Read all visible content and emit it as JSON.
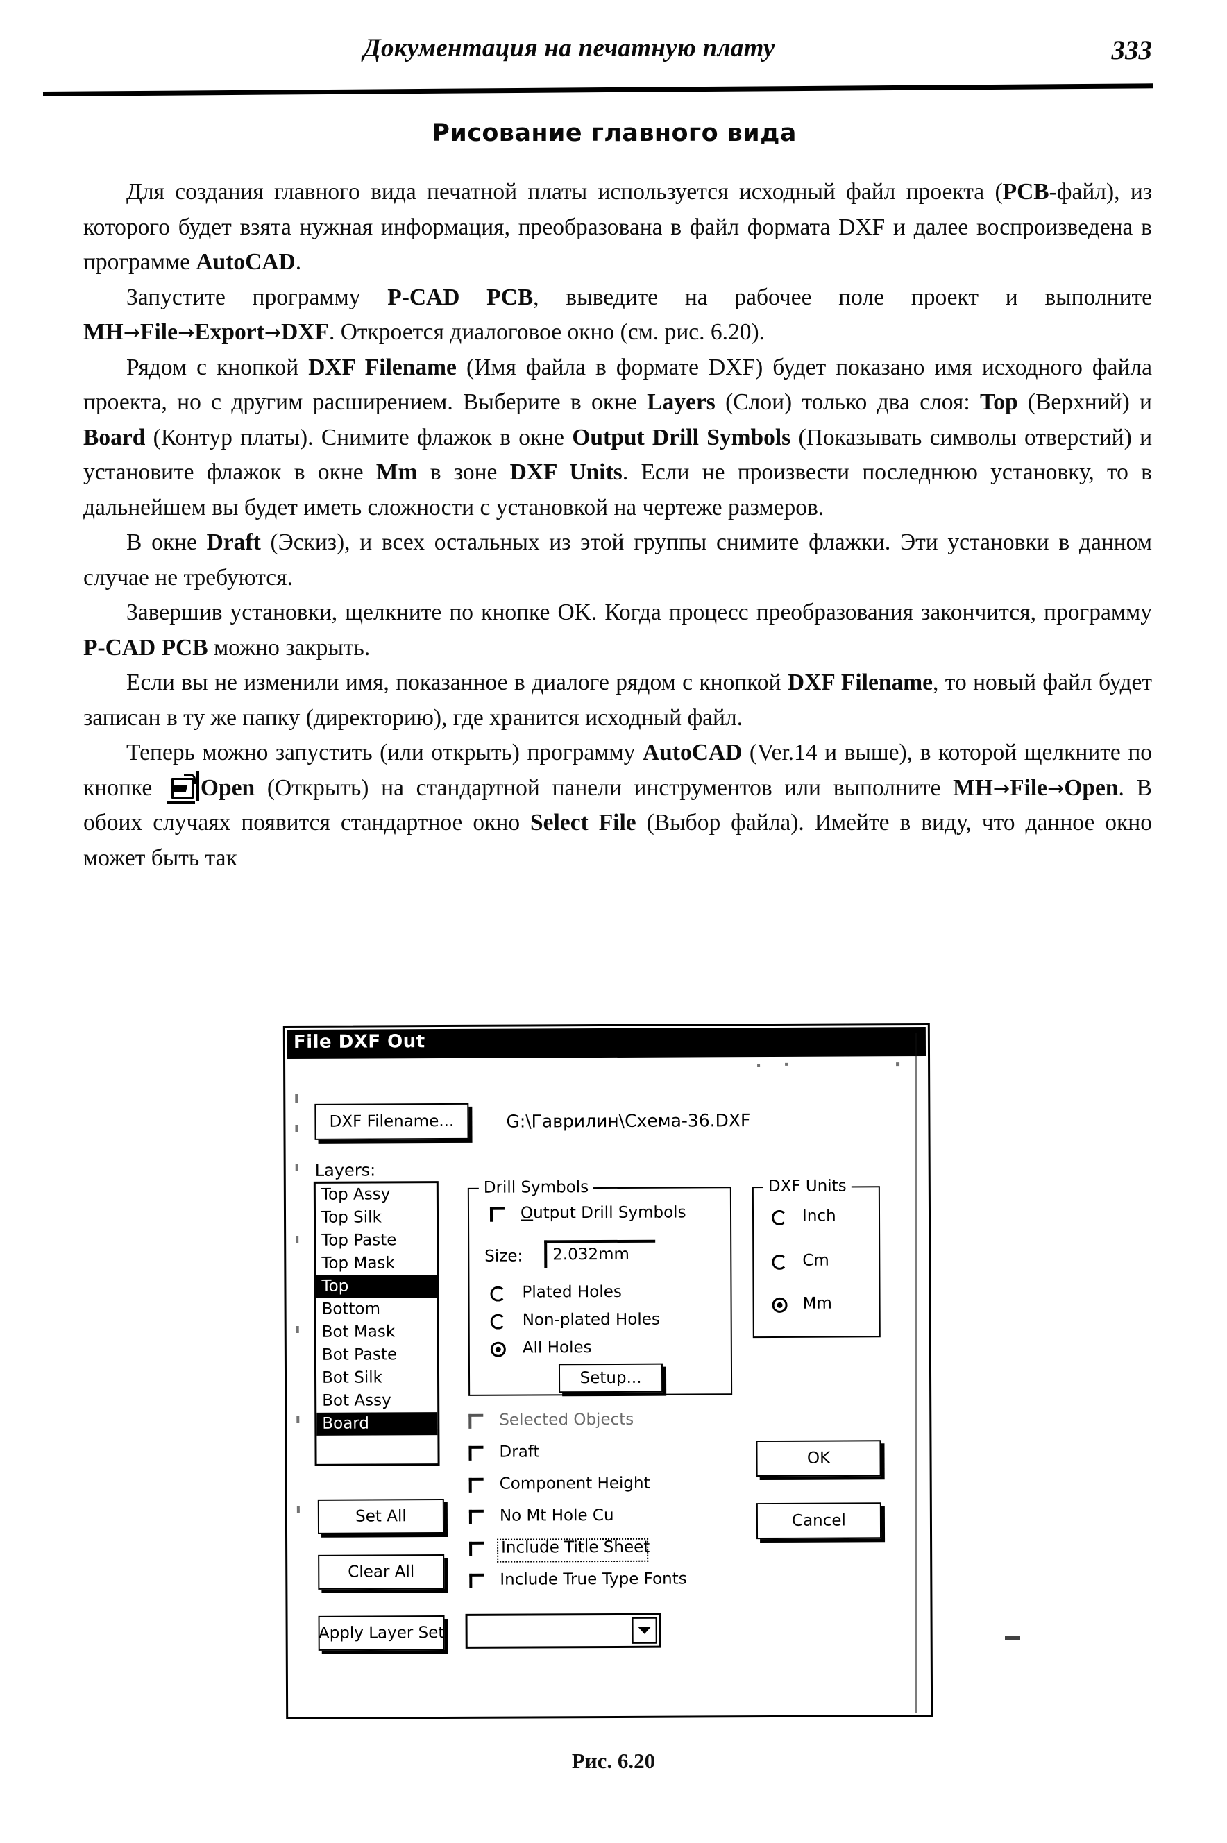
{
  "header": {
    "running_title": "Документация на печатную плату",
    "page_number": "333"
  },
  "section": {
    "heading": "Рисование главного вида"
  },
  "paragraphs": {
    "p1_a": "Для создания главного вида печатной платы используется исходный файл проекта (",
    "p1_b": "PCB",
    "p1_c": "-файл), из которого будет взята нужная информация, преобразована в файл формата DXF и далее воспроизведена в программе ",
    "p1_d": "AutoCAD",
    "p1_e": ".",
    "p2_a": "Запустите программу ",
    "p2_b": "P-CAD PCB",
    "p2_c": ", выведите на рабочее поле проект и выполните ",
    "p2_d": "MH",
    "p2_arrow1": "→",
    "p2_e": "File",
    "p2_arrow2": "→",
    "p2_f": "Export",
    "p2_arrow3": "→",
    "p2_g": "DXF",
    "p2_h": ". Откроется диалоговое окно (см. рис. 6.20).",
    "p3_a": "Рядом с кнопкой ",
    "p3_b": "DXF Filename",
    "p3_c": " (Имя файла в формате DXF) будет показано имя исходного файла проекта, но с другим расширением. Выберите в окне ",
    "p3_d": "Layers",
    "p3_e": " (Слои) только два слоя: ",
    "p3_f": "Top",
    "p3_g": " (Верхний) и ",
    "p3_h": "Board",
    "p3_i": " (Контур платы). Снимите флажок в окне ",
    "p3_j": "Output Drill Symbols",
    "p3_k": " (Показывать символы отверстий) и установите флажок в окне ",
    "p3_l": "Mm",
    "p3_m": " в зоне ",
    "p3_n": "DXF Units",
    "p3_o": ". Если не произвести последнюю установку, то в дальнейшем вы будет иметь сложности с установкой на чертеже размеров.",
    "p4_a": "В окне ",
    "p4_b": "Draft",
    "p4_c": " (Эскиз), и всех остальных из этой группы снимите флажки. Эти установки в данном случае не требуются.",
    "p5_a": "Завершив установки, щелкните по кнопке ",
    "p5_b": "OK",
    "p5_c": ". Когда процесс преобразования закончится, программу ",
    "p5_d": "P-CAD PCB",
    "p5_e": " можно закрыть.",
    "p6_a": "Если вы не изменили имя, показанное в диалоге рядом с кнопкой ",
    "p6_b": "DXF Filename",
    "p6_c": ", то новый файл будет записан в ту же папку (директорию), где хранится исходный файл.",
    "p7_a": "Теперь можно запустить (или открыть) программу ",
    "p7_b": "AutoCAD",
    "p7_c": " (Ver.14 и выше), в которой щелкните по кнопке ",
    "p7_icon": "open-folder-icon",
    "p7_d": "Open",
    "p7_e": " (Открыть) на стандартной панели инструментов или выполните ",
    "p7_f": "MH",
    "p7_arrow1": "→",
    "p7_g": "File",
    "p7_arrow2": "→",
    "p7_h": "Open",
    "p7_i": ". В обоих случаях появится стандартное окно ",
    "p7_j": "Select File",
    "p7_k": " (Выбор файла). Имейте в виду, что данное окно может быть так"
  },
  "dialog": {
    "title": "File DXF Out",
    "filename_button": "DXF Filename...",
    "filename_value": "G:\\Гаврилин\\Схема-36.DXF",
    "layers_label": "Layers:",
    "layers": [
      {
        "name": "Top Assy",
        "selected": false
      },
      {
        "name": "Top Silk",
        "selected": false
      },
      {
        "name": "Top Paste",
        "selected": false
      },
      {
        "name": "Top Mask",
        "selected": false
      },
      {
        "name": "Top",
        "selected": true
      },
      {
        "name": "Bottom",
        "selected": false
      },
      {
        "name": "Bot Mask",
        "selected": false
      },
      {
        "name": "Bot Paste",
        "selected": false
      },
      {
        "name": "Bot Silk",
        "selected": false
      },
      {
        "name": "Bot Assy",
        "selected": false
      },
      {
        "name": "Board",
        "selected": true
      }
    ],
    "drill_group": {
      "title": "Drill Symbols",
      "output_checkbox": "Output Drill Symbols",
      "output_checked": false,
      "size_label": "Size:",
      "size_value": "2.032mm",
      "radios": [
        {
          "label": "Plated Holes",
          "selected": false
        },
        {
          "label": "Non-plated Holes",
          "selected": false
        },
        {
          "label": "All Holes",
          "selected": true
        }
      ],
      "setup_button": "Setup..."
    },
    "units_group": {
      "title": "DXF Units",
      "radios": [
        {
          "label": "Inch",
          "selected": false
        },
        {
          "label": "Cm",
          "selected": false
        },
        {
          "label": "Mm",
          "selected": true
        }
      ]
    },
    "options": [
      {
        "label": "Selected Objects",
        "checked": false,
        "disabled": true,
        "focused": false
      },
      {
        "label": "Draft",
        "checked": false,
        "disabled": false,
        "focused": false
      },
      {
        "label": "Component Height",
        "checked": false,
        "disabled": false,
        "focused": false
      },
      {
        "label": "No Mt Hole Cu",
        "checked": false,
        "disabled": false,
        "focused": false
      },
      {
        "label": "Include Title Sheet",
        "checked": false,
        "disabled": false,
        "focused": true
      },
      {
        "label": "Include True Type Fonts",
        "checked": false,
        "disabled": false,
        "focused": false
      }
    ],
    "left_buttons": [
      {
        "label": "Set All"
      },
      {
        "label": "Clear All"
      },
      {
        "label": "Apply Layer Set"
      }
    ],
    "ok_button": "OK",
    "cancel_button": "Cancel",
    "layer_set_combo_value": ""
  },
  "figure": {
    "caption": "Рис. 6.20"
  },
  "colors": {
    "ink": "#000000",
    "paper": "#ffffff",
    "selection_bg": "#000000",
    "selection_fg": "#ffffff"
  }
}
